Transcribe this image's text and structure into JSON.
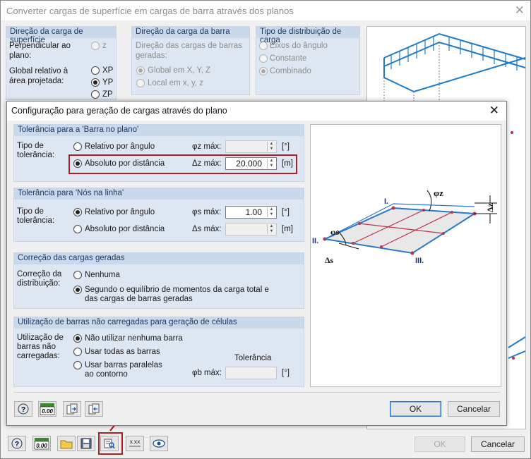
{
  "main": {
    "title": "Converter cargas de superfície em cargas de barra através dos planos",
    "close_glyph": "✕",
    "surface_dir": {
      "header": "Direção da carga de superfície",
      "perp_label": "Perpendicular ao plano:",
      "perp_opt": "z",
      "global_label": "Global relativo à área projetada:",
      "opts": [
        "XP",
        "YP",
        "ZP"
      ],
      "selected": "YP"
    },
    "member_dir": {
      "header": "Direção da carga da barra",
      "desc": "Direção das cargas de barras geradas:",
      "opts": [
        "Global em X, Y, Z",
        "Local em x, y, z"
      ],
      "selected": "Global em X, Y, Z"
    },
    "dist_type": {
      "header": "Tipo de distribuição de carga",
      "opts": [
        "Eixos do ângulo",
        "Constante",
        "Combinado"
      ],
      "selected": "Combinado"
    },
    "ok": "OK",
    "cancel": "Cancelar",
    "icons": [
      "help-icon",
      "units-icon",
      "open-icon",
      "save-icon",
      "generation-settings-icon",
      "decimal-icon",
      "view-icon"
    ],
    "units_text": "0.00",
    "decimal_text": "X.XX"
  },
  "dialog": {
    "title": "Configuração para geração de cargas através do plano",
    "close_glyph": "✕",
    "tol_member": {
      "header": "Tolerância para a  'Barra  no plano'",
      "type_label": "Tipo de tolerância:",
      "opt_rel": "Relativo por ângulo",
      "opt_abs": "Absoluto por distância",
      "selected": "Absoluto por distância",
      "phi_label": "φz máx:",
      "phi_value": "",
      "phi_unit": "[°]",
      "delta_label": "Δz máx:",
      "delta_value": "20.000",
      "delta_unit": "[m]"
    },
    "tol_nodes": {
      "header": "Tolerância para 'Nós na linha'",
      "type_label": "Tipo de tolerância:",
      "opt_rel": "Relativo por ângulo",
      "opt_abs": "Absoluto por distância",
      "selected": "Relativo por ângulo",
      "phi_label": "φs máx:",
      "phi_value": "1.00",
      "phi_unit": "[°]",
      "delta_label": "Δs máx:",
      "delta_value": "",
      "delta_unit": "[m]"
    },
    "correction": {
      "header": "Correção das cargas geradas",
      "label": "Correção da distribuição:",
      "opt_none": "Nenhuma",
      "opt_moment": "Segundo o equilíbrio de momentos da carga total e das cargas de barras geradas",
      "selected": "Segundo o equilíbrio de momentos da carga total e das cargas de barras geradas"
    },
    "unloaded": {
      "header": "Utilização de barras não carregadas para geração de células",
      "label": "Utilização de barras não carregadas:",
      "opts": [
        "Não utilizar nenhuma barra",
        "Usar todas as barras",
        "Usar barras paralelas ao contorno"
      ],
      "selected": "Não utilizar nenhuma barra",
      "tol_header": "Tolerância",
      "phi_label": "φb máx:",
      "phi_value": "",
      "phi_unit": "[°]"
    },
    "ok": "OK",
    "cancel": "Cancelar",
    "units_text": "0.00",
    "icons": [
      "help-icon",
      "units-icon",
      "import-icon",
      "export-icon"
    ]
  },
  "diagram": {
    "labels": [
      "I.",
      "II.",
      "III.",
      "φz",
      "Δz",
      "φs",
      "Δs"
    ]
  },
  "colors": {
    "group_bg": "#dde6f1",
    "group_header": "#c9d8eb",
    "accent_blue": "#2a78c8",
    "highlight_red": "#b01e25"
  }
}
